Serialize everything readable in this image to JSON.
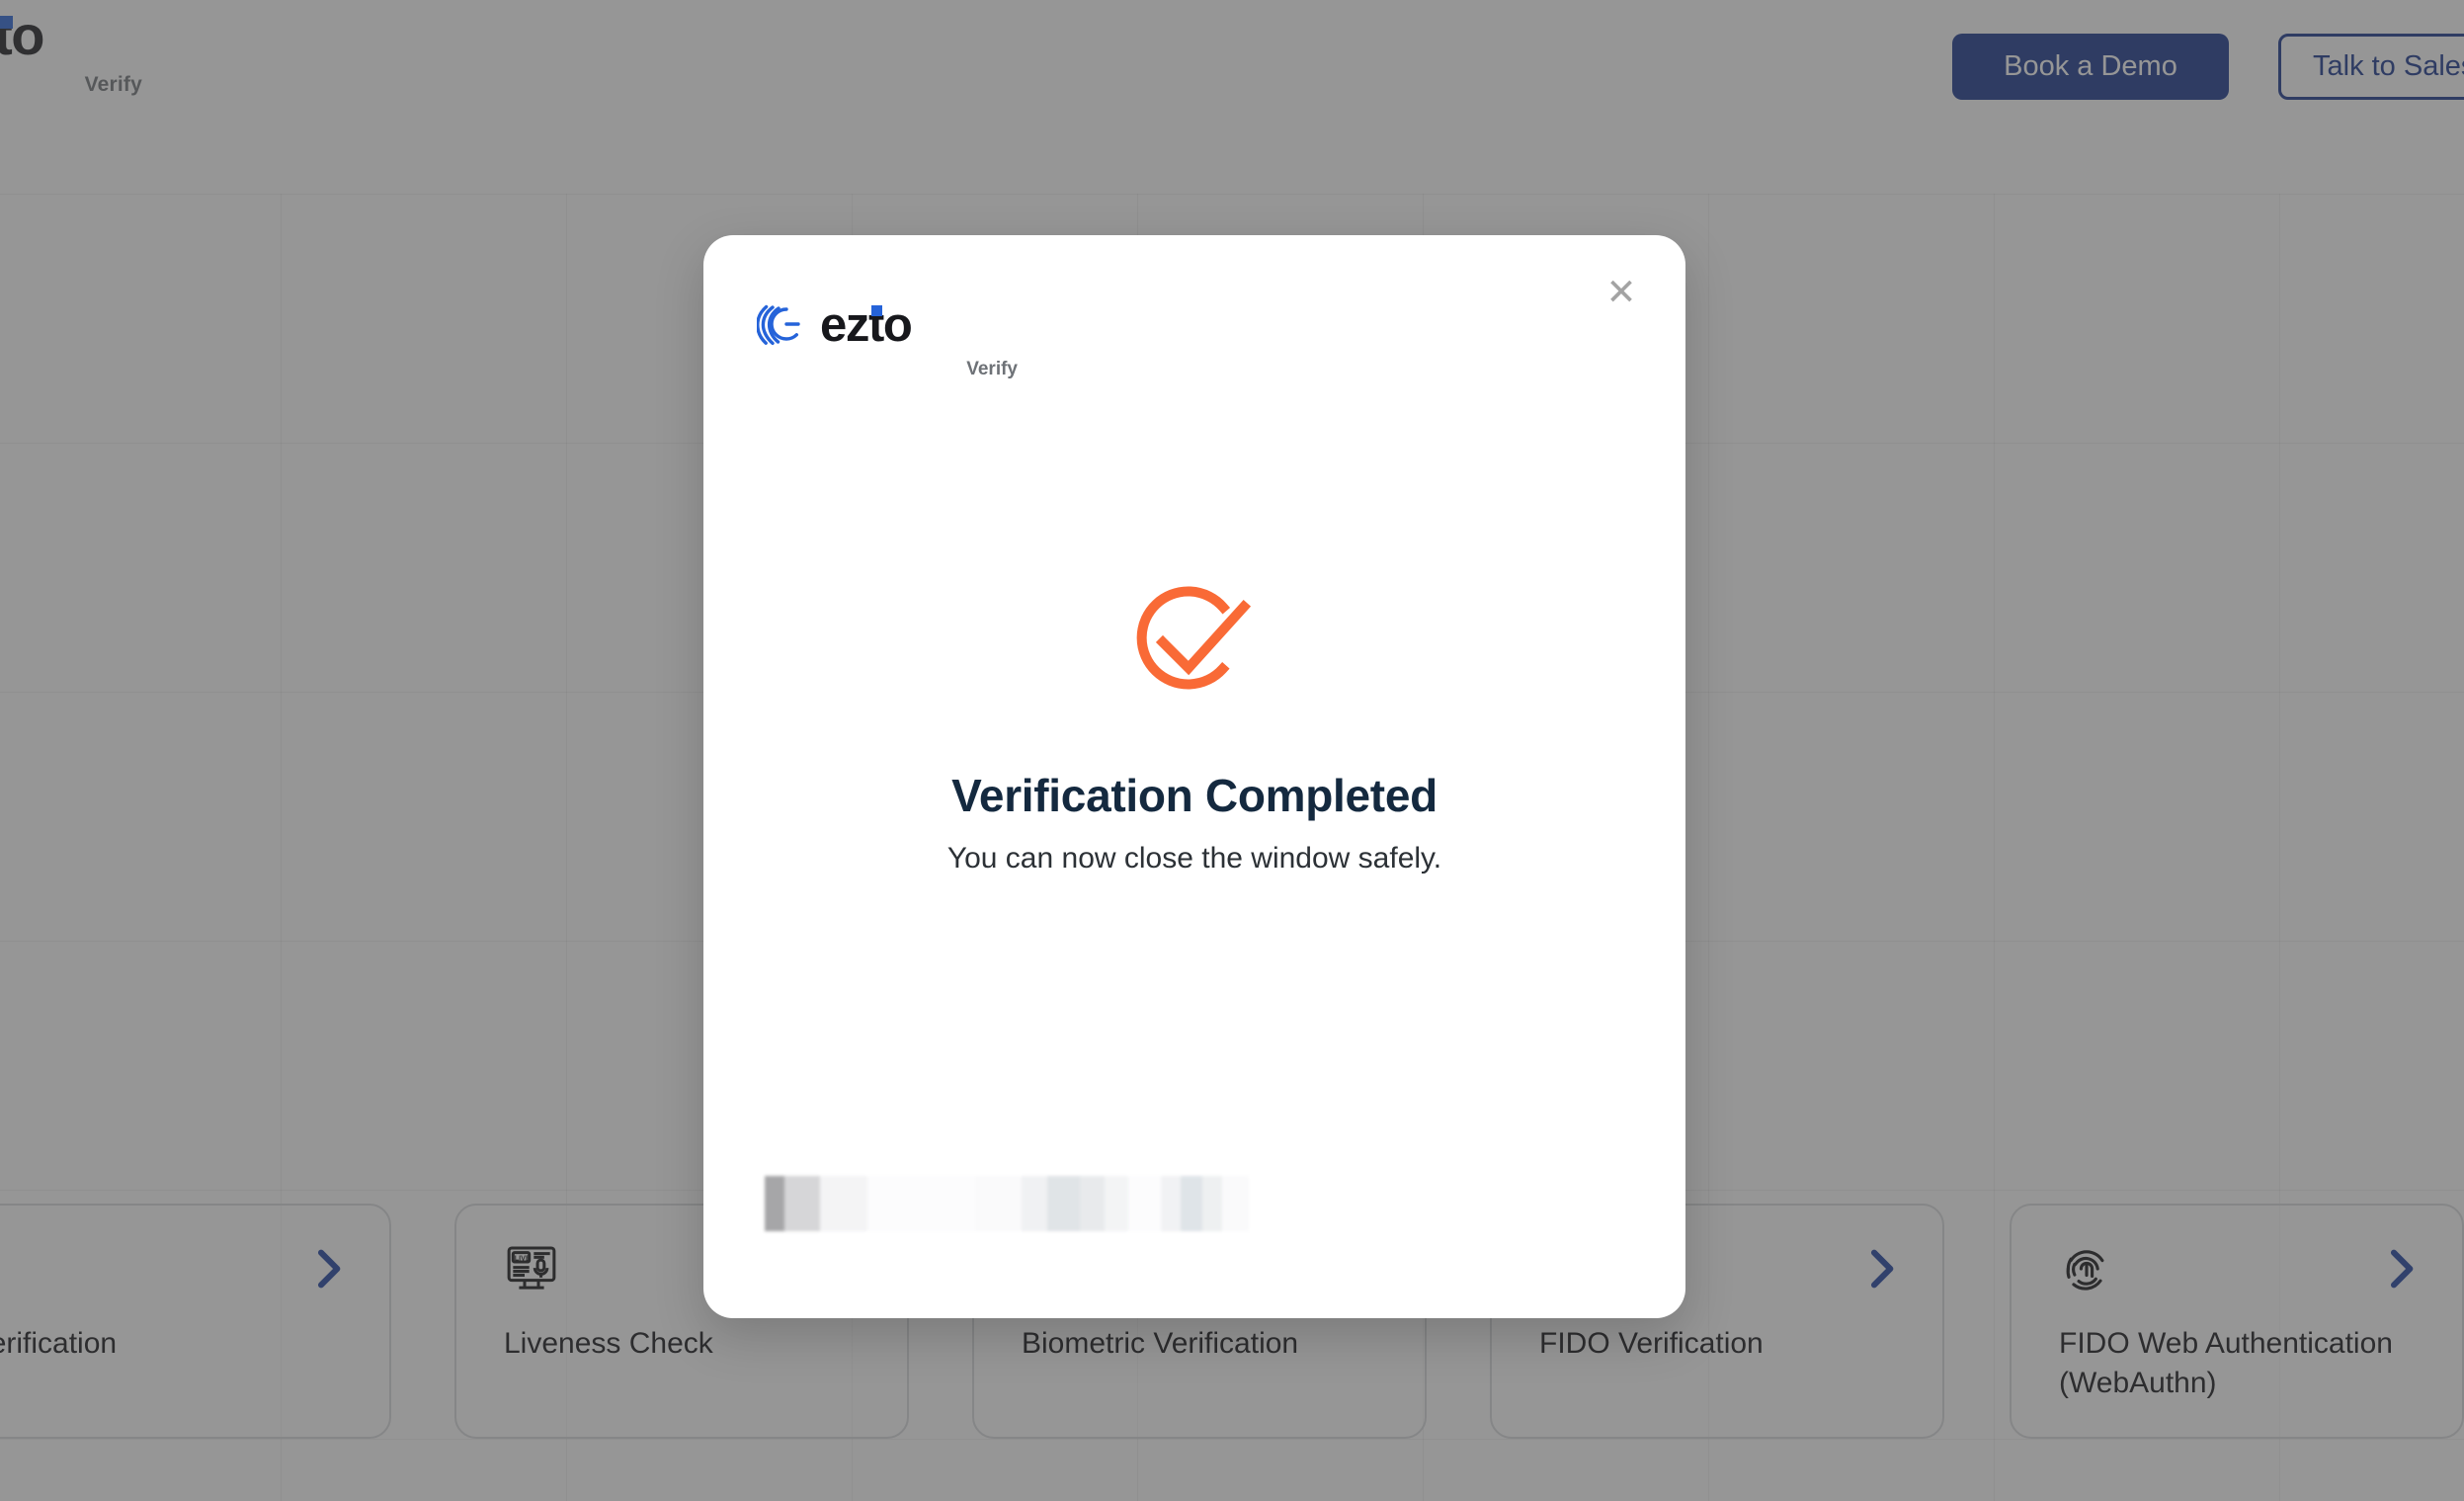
{
  "topbar": {
    "brand": {
      "wordmark": "ezto",
      "visible_fragment": "to",
      "sub": "Verify"
    },
    "book_demo_label": "Book a Demo",
    "talk_sales_label": "Talk to Sales",
    "accent_blue": "#15338c"
  },
  "cards": [
    {
      "label": "SMS Verification",
      "icon": "sms-chat-icon",
      "chevron": "chevron-right-icon"
    },
    {
      "label": "Liveness Check",
      "icon": "live-monitor-icon",
      "chevron": "chevron-right-icon"
    },
    {
      "label": "Biometric Verification",
      "icon": "face-scan-icon",
      "chevron": "chevron-right-icon"
    },
    {
      "label": "FIDO Verification",
      "icon": "security-key-icon",
      "chevron": "chevron-right-icon"
    },
    {
      "label": "FIDO Web Authentication (WebAuthn)",
      "icon": "fingerprint-icon",
      "chevron": "chevron-right-icon"
    }
  ],
  "modal": {
    "close_label": "✕",
    "brand": {
      "wordmark": "ezto",
      "sub": "Verify",
      "mark_color": "#2563d9"
    },
    "status_icon": "check-circle-icon",
    "status_icon_color": "#f96a36",
    "title": "Verification Completed",
    "subtitle": "You can now close the window safely.",
    "title_color": "#14293f",
    "redacted_note": ""
  },
  "overlay": {
    "color": "rgba(68,68,68,0.56)"
  }
}
